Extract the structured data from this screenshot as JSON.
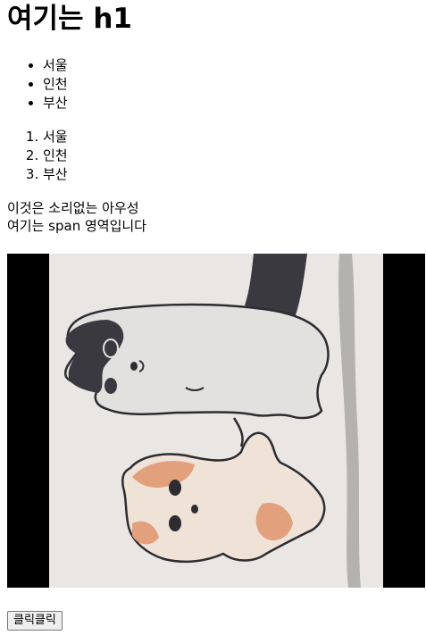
{
  "heading": "여기는 h1",
  "unordered_list": [
    "서울",
    "인천",
    "부산"
  ],
  "ordered_list": [
    "서울",
    "인천",
    "부산"
  ],
  "text_line_1": "이것은 소리없는 아우성",
  "text_line_2": "여기는 span 영역입니다",
  "button_label": "클릭클릭",
  "colors": {
    "video_letterbox": "#000000",
    "paper": "#e9e6e3",
    "cat_gray": "#3a393f",
    "shiba_orange": "#e2a07c"
  }
}
